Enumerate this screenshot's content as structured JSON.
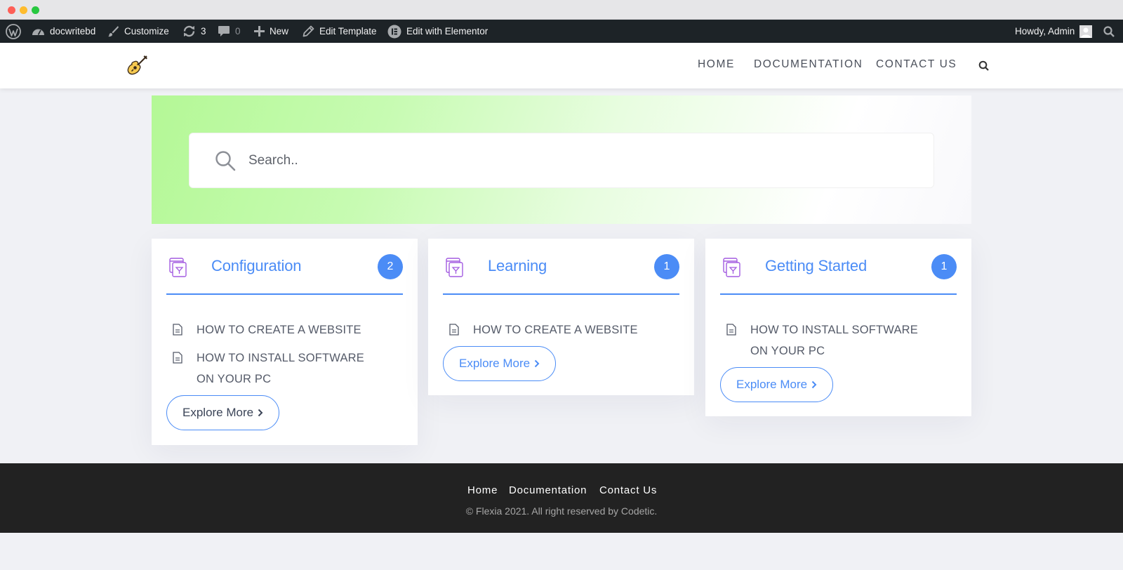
{
  "admin_bar": {
    "site_name": "docwritebd",
    "customize": "Customize",
    "updates_count": "3",
    "comments_count": "0",
    "new": "New",
    "edit_template": "Edit Template",
    "edit_elementor": "Edit with Elementor",
    "howdy": "Howdy, Admin"
  },
  "nav": {
    "items": [
      "HOME",
      "DOCUMENTATION",
      "CONTACT US"
    ]
  },
  "search": {
    "placeholder": "Search.."
  },
  "categories": [
    {
      "title": "Configuration",
      "count": "2",
      "docs": [
        "HOW TO CREATE A WEBSITE",
        "HOW TO INSTALL SOFTWARE ON YOUR PC"
      ],
      "button": "Explore More"
    },
    {
      "title": "Learning",
      "count": "1",
      "docs": [
        "HOW TO CREATE A WEBSITE"
      ],
      "button": "Explore More"
    },
    {
      "title": "Getting Started",
      "count": "1",
      "docs": [
        "HOW TO INSTALL SOFTWARE ON YOUR PC"
      ],
      "button": "Explore More"
    }
  ],
  "footer": {
    "links": [
      "Home",
      "Documentation",
      "Contact Us"
    ],
    "copyright": "© Flexia 2021. All right reserved by Codetic."
  },
  "colors": {
    "accent": "#4b8cf6",
    "admin_bar": "#1d2327",
    "footer": "#222222",
    "hero_gradient_start": "#b4f896"
  },
  "icons": {
    "wordpress": "wordpress-logo-icon",
    "dashboard": "dashboard-icon",
    "customize": "brush-icon",
    "updates": "refresh-icon",
    "comments": "comment-icon",
    "new": "plus-icon",
    "edit": "pencil-icon",
    "elementor": "elementor-icon",
    "search": "search-icon",
    "category": "folder-document-icon",
    "doc": "document-icon",
    "chevron": "chevron-right-icon",
    "logo": "guitar-icon"
  }
}
